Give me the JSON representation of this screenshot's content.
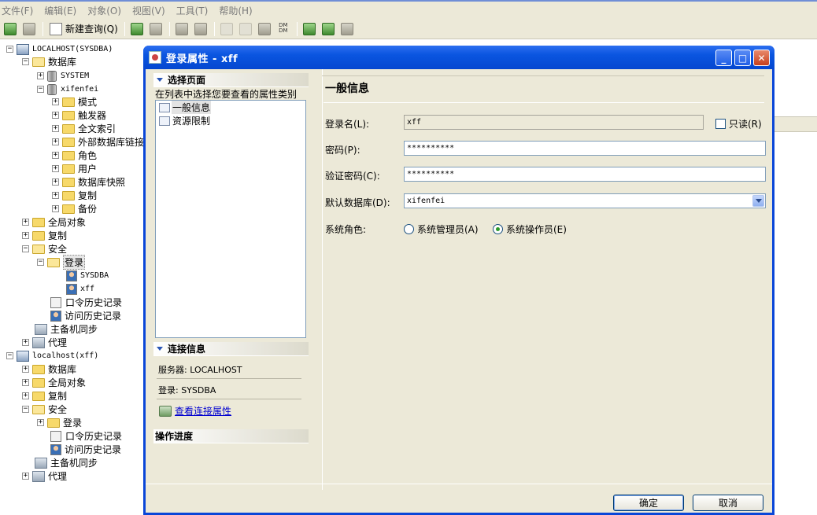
{
  "menu": [
    "文件(F)",
    "编辑(E)",
    "对象(O)",
    "视图(V)",
    "工具(T)",
    "帮助(H)"
  ],
  "toolbar": {
    "new_query_label": "新建查询(Q)",
    "dm_label": "DM DM"
  },
  "tree": {
    "server1": "LOCALHOST(SYSDBA)",
    "databases": "数据库",
    "db_system": "SYSTEM",
    "db_xifenfei": "xifenfei",
    "schema": "模式",
    "triggers": "触发器",
    "fulltext": "全文索引",
    "external_links": "外部数据库链接",
    "roles": "角色",
    "users": "用户",
    "snapshots": "数据库快照",
    "replication": "复制",
    "backup": "备份",
    "global_objects": "全局对象",
    "replication2": "复制",
    "security": "安全",
    "logins": "登录",
    "login_sysdba": "SYSDBA",
    "login_xff": "xff",
    "pwd_history": "口令历史记录",
    "access_history": "访问历史记录",
    "master_standby": "主备机同步",
    "agent": "代理",
    "server2": "localhost(xff)",
    "s2_databases": "数据库",
    "s2_global_objects": "全局对象",
    "s2_replication": "复制",
    "s2_security": "安全",
    "s2_logins": "登录",
    "s2_pwd_history": "口令历史记录",
    "s2_access_history": "访问历史记录",
    "s2_master_standby": "主备机同步",
    "s2_agent": "代理"
  },
  "dialog": {
    "title": "登录属性 - xff",
    "select_page": "选择页面",
    "select_hint": "在列表中选择您要查看的属性类别",
    "pages": [
      "一般信息",
      "资源限制"
    ],
    "conn_info": "连接信息",
    "server_line": "服务器: LOCALHOST",
    "login_line": "登录: SYSDBA",
    "view_conn": "查看连接属性",
    "progress": "操作进度",
    "panel_title": "一般信息",
    "login_name_label": "登录名(L):",
    "login_name_value": "xff",
    "readonly_label": "只读(R)",
    "password_label": "密码(P):",
    "password_value": "**********",
    "confirm_label": "验证密码(C):",
    "confirm_value": "**********",
    "default_db_label": "默认数据库(D):",
    "default_db_value": "xifenfei",
    "role_label": "系统角色:",
    "role_admin": "系统管理员(A)",
    "role_operator": "系统操作员(E)",
    "selected_role": "operator",
    "ok": "确定",
    "cancel": "取消"
  }
}
